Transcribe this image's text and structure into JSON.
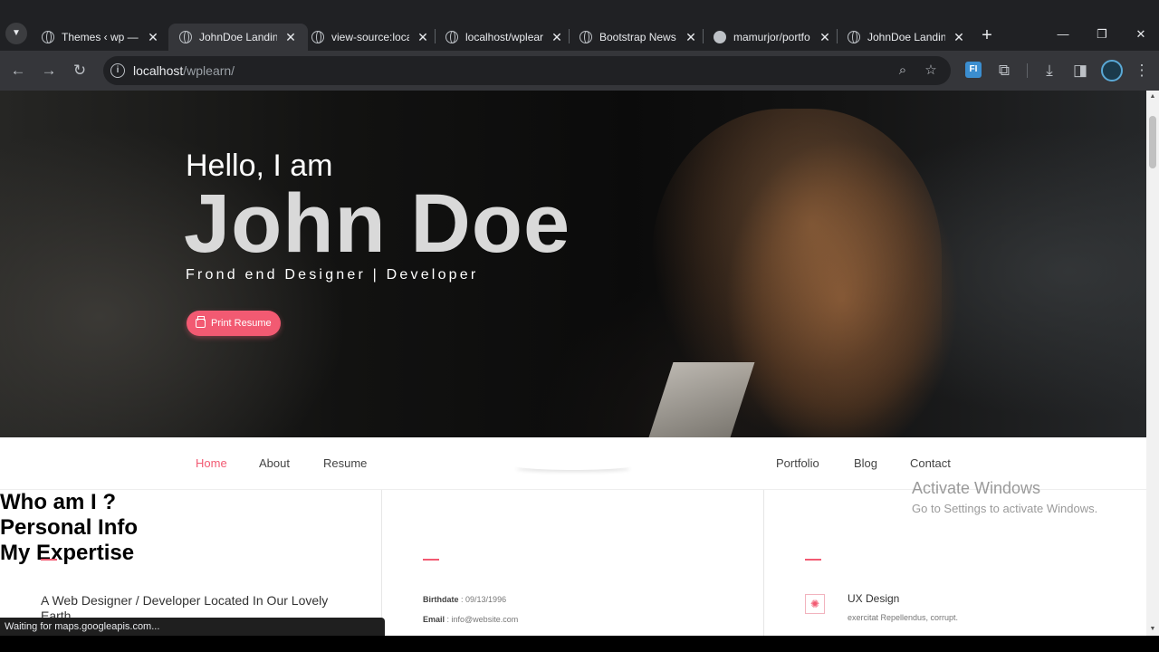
{
  "browser": {
    "tabs": [
      {
        "title": "Themes ‹ wp — W",
        "icon": "globe-icon"
      },
      {
        "title": "JohnDoe Landing",
        "icon": "globe-icon",
        "active": true
      },
      {
        "title": "view-source:local",
        "icon": "globe-icon"
      },
      {
        "title": "localhost/wplearn",
        "icon": "globe-icon"
      },
      {
        "title": "Bootstrap News",
        "icon": "globe-icon"
      },
      {
        "title": "mamurjor/portfo",
        "icon": "github-icon"
      },
      {
        "title": "JohnDoe Landing",
        "icon": "globe-icon"
      }
    ],
    "address": {
      "host": "localhost",
      "path": "/wplearn/"
    },
    "extension_label": "FI",
    "status_text": "Waiting for maps.googleapis.com..."
  },
  "hero": {
    "greeting": "Hello, I am",
    "name": "John Doe",
    "role": "Frond end Designer | Developer",
    "print_button": "Print Resume"
  },
  "nav": {
    "left": [
      "Home",
      "About",
      "Resume"
    ],
    "right": [
      "Portfolio",
      "Blog",
      "Contact"
    ],
    "active": "Home"
  },
  "who": {
    "heading": "Who am I ?",
    "text": "A Web Designer / Developer Located In Our Lovely Earth"
  },
  "personal": {
    "heading": "Personal Info",
    "birthdate_label": "Birthdate",
    "birthdate_value": "09/13/1996",
    "email_label": "Email",
    "email_value": "info@website.com"
  },
  "expertise": {
    "heading": "My Expertise",
    "item_title": "UX Design",
    "item_desc": "exercitat Repellendus, corrupt."
  },
  "watermark": {
    "line1": "Activate Windows",
    "line2": "Go to Settings to activate Windows."
  },
  "colors": {
    "accent": "#f25a72",
    "chrome_dark": "#202124",
    "chrome_toolbar": "#35363a"
  }
}
